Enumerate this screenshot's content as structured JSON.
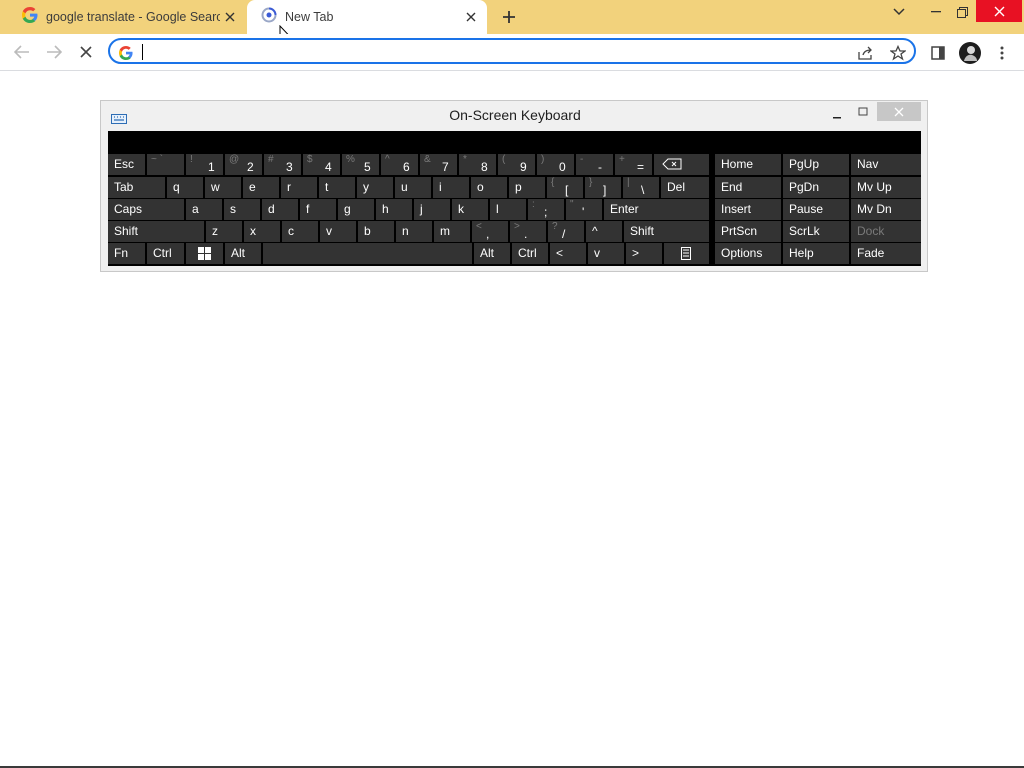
{
  "browser": {
    "tabs": [
      {
        "title": "google translate - Google Search",
        "favicon": "google-g-icon"
      },
      {
        "title": "New Tab",
        "favicon": "chrome-loading-icon"
      }
    ],
    "omnibox": {
      "value": "",
      "placeholder": ""
    }
  },
  "osk": {
    "title": "On-Screen Keyboard",
    "rows": {
      "r0": {
        "esc": "Esc"
      },
      "r1": {
        "tab": "Tab",
        "q": "q",
        "w": "w",
        "e": "e",
        "r": "r",
        "t": "t",
        "y": "y",
        "u": "u",
        "i": "i",
        "o": "o",
        "p": "p",
        "del": "Del"
      },
      "r2": {
        "caps": "Caps",
        "a": "a",
        "s": "s",
        "d": "d",
        "f": "f",
        "g": "g",
        "h": "h",
        "j": "j",
        "k": "k",
        "l": "l",
        "enter": "Enter"
      },
      "r3": {
        "shift_l": "Shift",
        "z": "z",
        "x": "x",
        "c": "c",
        "v": "v",
        "b": "b",
        "n": "n",
        "m": "m",
        "up": "^",
        "shift_r": "Shift"
      },
      "r4": {
        "fn": "Fn",
        "ctrl_l": "Ctrl",
        "alt_l": "Alt",
        "alt_r": "Alt",
        "ctrl_r": "Ctrl",
        "left": "<",
        "down": "v",
        "right": ">"
      }
    },
    "numrow": [
      {
        "shift": "~ `",
        "base": ""
      },
      {
        "shift": "!",
        "base": "1"
      },
      {
        "shift": "@",
        "base": "2"
      },
      {
        "shift": "#",
        "base": "3"
      },
      {
        "shift": "$",
        "base": "4"
      },
      {
        "shift": "%",
        "base": "5"
      },
      {
        "shift": "^",
        "base": "6"
      },
      {
        "shift": "&",
        "base": "7"
      },
      {
        "shift": "*",
        "base": "8"
      },
      {
        "shift": "(",
        "base": "9"
      },
      {
        "shift": ")",
        "base": "0"
      },
      {
        "shift": "-",
        "base": "-"
      },
      {
        "shift": "+",
        "base": "="
      }
    ],
    "punct": {
      "lbracket": {
        "shift": "{",
        "base": "["
      },
      "rbracket": {
        "shift": "}",
        "base": "]"
      },
      "backslash": {
        "shift": "|",
        "base": "\\"
      },
      "semicolon": {
        "shift": ":",
        "base": ";"
      },
      "quote": {
        "shift": "\"",
        "base": "'"
      },
      "comma": {
        "shift": "<",
        "base": ","
      },
      "period": {
        "shift": ">",
        "base": "."
      },
      "slash": {
        "shift": "?",
        "base": "/"
      }
    },
    "nav": [
      [
        "Home",
        "PgUp",
        "Nav"
      ],
      [
        "End",
        "PgDn",
        "Mv Up"
      ],
      [
        "Insert",
        "Pause",
        "Mv Dn"
      ],
      [
        "PrtScn",
        "ScrLk",
        "Dock"
      ],
      [
        "Options",
        "Help",
        "Fade"
      ]
    ]
  }
}
